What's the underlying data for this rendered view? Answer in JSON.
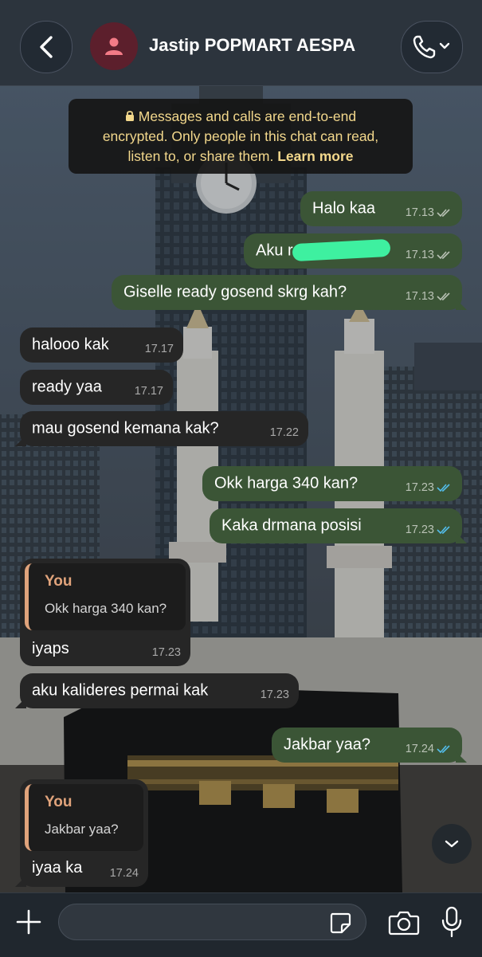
{
  "header": {
    "title": "Jastip POPMART AESPA",
    "back_icon": "chevron-left-icon",
    "avatar_icon": "person-icon",
    "call_icon": "phone-icon"
  },
  "notice": {
    "line1": "Messages and calls are end-to-end",
    "line2": "encrypted. Only people in this chat can read,",
    "line3_prefix": "listen to, or share them.",
    "learn_more": "Learn more"
  },
  "messages": [
    {
      "dir": "out",
      "text": "Halo kaa",
      "time": "17.13",
      "status": "delivered"
    },
    {
      "dir": "out",
      "text": "Aku r",
      "time": "17.13",
      "status": "delivered",
      "redacted": true
    },
    {
      "dir": "out",
      "text": "Giselle ready gosend skrg kah?",
      "time": "17.13",
      "status": "delivered"
    },
    {
      "dir": "in",
      "text": "halooo kak",
      "time": "17.17"
    },
    {
      "dir": "in",
      "text": "ready yaa",
      "time": "17.17"
    },
    {
      "dir": "in",
      "text": "mau gosend kemana kak?",
      "time": "17.22"
    },
    {
      "dir": "out",
      "text": "Okk harga 340 kan?",
      "time": "17.23",
      "status": "read"
    },
    {
      "dir": "out",
      "text": "Kaka drmana posisi",
      "time": "17.23",
      "status": "read"
    },
    {
      "dir": "in",
      "reply_to": {
        "author": "You",
        "text": "Okk harga 340 kan?"
      },
      "text": "iyaps",
      "time": "17.23"
    },
    {
      "dir": "in",
      "text": "aku kalideres permai kak",
      "time": "17.23"
    },
    {
      "dir": "out",
      "text": "Jakbar yaa?",
      "time": "17.24",
      "status": "read"
    },
    {
      "dir": "in",
      "reply_to": {
        "author": "You",
        "text": "Jakbar yaa?"
      },
      "text": "iyaa ka",
      "time": "17.24"
    }
  ],
  "composer": {
    "value": "",
    "placeholder": "",
    "icons": [
      "plus-icon",
      "sticker-icon",
      "camera-icon",
      "microphone-icon"
    ]
  },
  "colors": {
    "outgoing_bubble": "#3b5536",
    "incoming_bubble": "#262626",
    "read_tick": "#53bdeb",
    "delivered_tick": "#b9c2b5",
    "notice_text": "#f3d88c",
    "quote_accent": "#e0a37b"
  }
}
